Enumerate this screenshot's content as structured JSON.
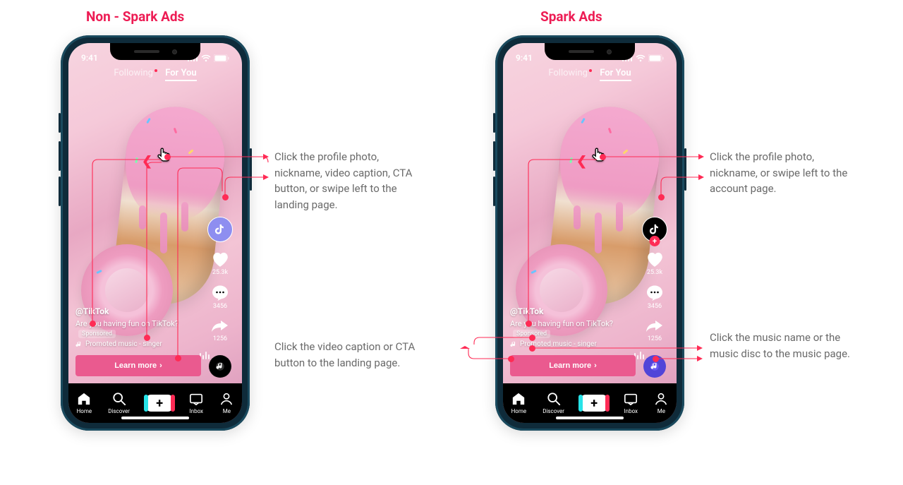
{
  "columns": {
    "left_title": "Non - Spark Ads",
    "right_title": "Spark Ads"
  },
  "phone": {
    "time": "9:41",
    "tabs": {
      "following": "Following",
      "for_you": "For You"
    },
    "rail": {
      "likes": "25.3k",
      "comments": "3456",
      "shares": "1256"
    },
    "meta": {
      "nickname": "@TikTok",
      "caption": "Are you having fun on TikTok?",
      "sponsored": "Sponsored",
      "music": "Promoted music - singer"
    },
    "cta": "Learn more",
    "tabbar": {
      "home": "Home",
      "discover": "Discover",
      "inbox": "Inbox",
      "me": "Me"
    }
  },
  "annotations": {
    "ns_top": "Click the profile photo, nickname, video caption, CTA button, or swipe left to the landing page.",
    "ns_bottom": "Click the video caption or CTA button to the landing page.",
    "sp_top": "Click the profile photo, nickname, or swipe left to the account page.",
    "sp_bottom": "Click the music name or the music disc to the music page."
  }
}
